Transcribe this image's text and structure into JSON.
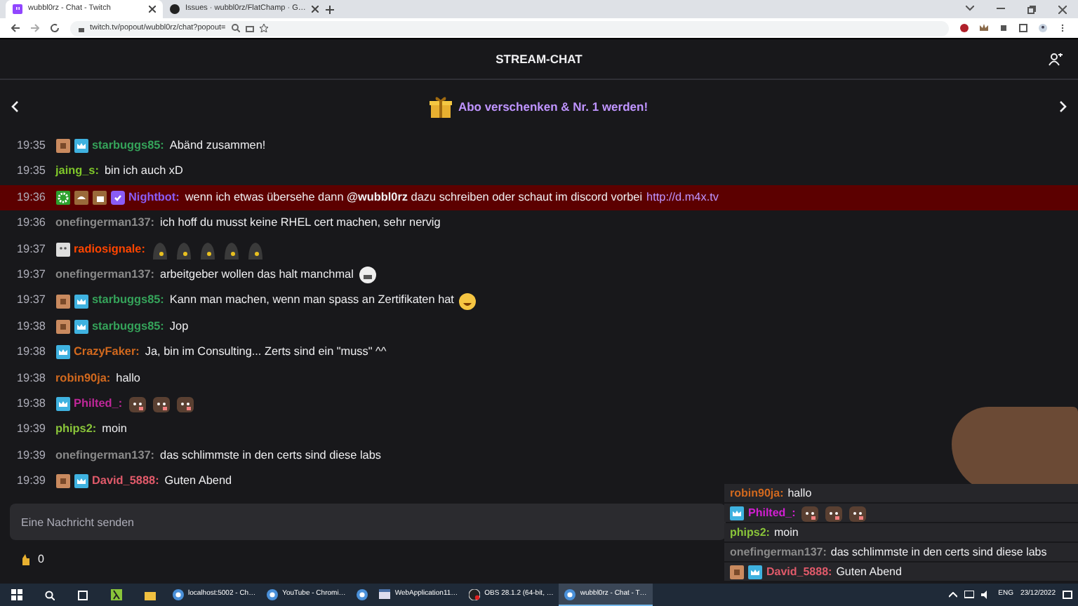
{
  "browser": {
    "tabs": [
      {
        "title": "wubbl0rz - Chat - Twitch",
        "selected": true,
        "kind": "twitch"
      },
      {
        "title": "Issues · wubbl0rz/FlatChamp · G…",
        "selected": false,
        "kind": "github"
      }
    ],
    "address": "twitch.tv/popout/wubbl0rz/chat?popout="
  },
  "header": {
    "title": "STREAM-CHAT"
  },
  "banner": {
    "text": "Abo verschenken & Nr. 1 werden!"
  },
  "messages": [
    {
      "time": "19:35",
      "badges": [
        {
          "kind": "tile"
        },
        {
          "kind": "crown"
        }
      ],
      "user": "starbuggs85:",
      "color": "#35a35a",
      "text": "Abänd zusammen!",
      "highlighted": false
    },
    {
      "time": "19:35",
      "user": "jaing_s:",
      "color": "#7fc72a",
      "text": "bin ich auch xD",
      "highlighted": false
    },
    {
      "time": "19:36",
      "badges": [
        {
          "kind": "gear"
        },
        {
          "kind": "hand"
        },
        {
          "kind": "thumb"
        },
        {
          "kind": "check"
        }
      ],
      "user": "Nightbot:",
      "color": "#8a5cf5",
      "text": "wenn ich etwas übersehe dann **@wubbl0rz** dazu schreiben oder schaut im discord vorbei",
      "link": "http://d.m4x.tv",
      "highlighted": true
    },
    {
      "time": "19:36",
      "user": "onefingerman137:",
      "color": "#8a8a8a",
      "text": "ich hoff du musst keine RHEL cert machen, sehr nervig",
      "highlighted": false
    },
    {
      "time": "19:37",
      "badges": [
        {
          "kind": "ghost"
        }
      ],
      "user": "radiosignale:",
      "color": "#ff4500",
      "emotes": [
        {
          "kind": "figure"
        },
        {
          "kind": "figure"
        },
        {
          "kind": "figure"
        },
        {
          "kind": "figure"
        },
        {
          "kind": "figure"
        }
      ],
      "highlighted": false
    },
    {
      "time": "19:37",
      "user": "onefingerman137:",
      "color": "#8a8a8a",
      "text": "arbeitgeber wollen das halt manchmal",
      "emotes": [
        {
          "kind": "grin"
        }
      ],
      "highlighted": false
    },
    {
      "time": "19:37",
      "badges": [
        {
          "kind": "tile"
        },
        {
          "kind": "crown"
        }
      ],
      "user": "starbuggs85:",
      "color": "#35a35a",
      "text": "Kann man machen, wenn man spass an Zertifikaten hat",
      "emotes": [
        {
          "kind": "laugh"
        }
      ],
      "highlighted": false
    },
    {
      "time": "19:38",
      "badges": [
        {
          "kind": "tile"
        },
        {
          "kind": "crown"
        }
      ],
      "user": "starbuggs85:",
      "color": "#35a35a",
      "text": "Jop",
      "highlighted": false
    },
    {
      "time": "19:38",
      "badges": [
        {
          "kind": "crown"
        }
      ],
      "user": "CrazyFaker:",
      "color": "#d2691e",
      "text": "Ja, bin im Consulting... Zerts sind ein \"muss\" ^^",
      "highlighted": false
    },
    {
      "time": "19:38",
      "user": "robin90ja:",
      "color": "#d2691e",
      "text": "hallo",
      "highlighted": false
    },
    {
      "time": "19:38",
      "badges": [
        {
          "kind": "crown"
        }
      ],
      "user": "Philted_:",
      "color": "#c0279a",
      "emotes": [
        {
          "kind": "bear"
        },
        {
          "kind": "bear"
        },
        {
          "kind": "bear"
        }
      ],
      "highlighted": false
    },
    {
      "time": "19:39",
      "user": "phips2:",
      "color": "#8ac53a",
      "text": "moin",
      "highlighted": false
    },
    {
      "time": "19:39",
      "user": "onefingerman137:",
      "color": "#8a8a8a",
      "text": "das schlimmste in den certs sind diese labs",
      "highlighted": false
    },
    {
      "time": "19:39",
      "badges": [
        {
          "kind": "tile"
        },
        {
          "kind": "crown"
        }
      ],
      "user": "David_5888:",
      "color": "#e05a6a",
      "text": "Guten Abend",
      "highlighted": false
    }
  ],
  "input": {
    "placeholder": "Eine Nachricht senden"
  },
  "points": "0",
  "overlay": {
    "messages": [
      {
        "user": "robin90ja:",
        "color": "#d2691e",
        "text": "hallo"
      },
      {
        "badges": [
          {
            "kind": "crown"
          }
        ],
        "user": "Philted_:",
        "color": "#d21fd2",
        "emotes": [
          {
            "kind": "bear"
          },
          {
            "kind": "bear"
          },
          {
            "kind": "bear"
          }
        ]
      },
      {
        "user": "phips2:",
        "color": "#8ac53a",
        "text": "moin"
      },
      {
        "user": "onefingerman137:",
        "color": "#8a8a8a",
        "text": "das schlimmste in den certs sind diese labs"
      },
      {
        "badges": [
          {
            "kind": "tile"
          },
          {
            "kind": "crown"
          }
        ],
        "user": "David_5888:",
        "color": "#e05a6a",
        "text": "Guten Abend"
      }
    ]
  },
  "taskbar": {
    "apps": [
      {
        "title": "localhost:5002 - Ch…",
        "kind": "chrome",
        "selected": false
      },
      {
        "title": "YouTube - Chromi…",
        "kind": "chrome",
        "selected": false
      },
      {
        "kind": "chrome",
        "selected": false
      },
      {
        "title": "WebApplication11…",
        "kind": "window",
        "selected": false
      },
      {
        "title": "OBS 28.1.2 (64-bit, …",
        "kind": "obs",
        "selected": false
      },
      {
        "title": "wubbl0rz - Chat - T…",
        "kind": "chrome",
        "selected": true
      }
    ],
    "language": "ENG",
    "date": "23/12/2022"
  }
}
